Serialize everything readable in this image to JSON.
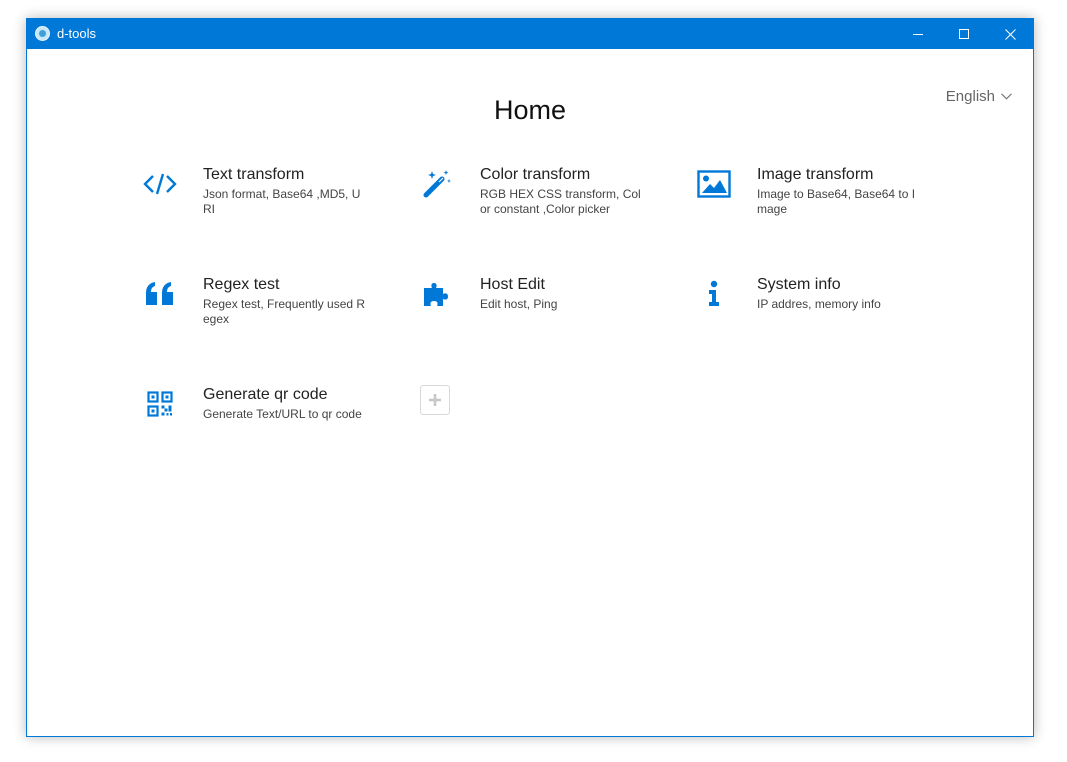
{
  "window": {
    "title": "d-tools",
    "accent": "#0078d7",
    "buttons": {
      "minimize": "minimize-icon",
      "maximize": "maximize-icon",
      "close": "close-icon"
    }
  },
  "header": {
    "title": "Home",
    "language": "English"
  },
  "tools": [
    {
      "name": "Text transform",
      "desc": "Json format, Base64 ,MD5, URI",
      "icon": "code-icon"
    },
    {
      "name": "Color transform",
      "desc": "RGB HEX CSS transform, Color constant ,Color picker",
      "icon": "magic-wand-icon"
    },
    {
      "name": "Image transform",
      "desc": "Image to Base64, Base64 to Image",
      "icon": "image-icon"
    },
    {
      "name": "Regex test",
      "desc": "Regex test, Frequently used Regex",
      "icon": "quote-icon"
    },
    {
      "name": "Host Edit",
      "desc": "Edit host, Ping",
      "icon": "puzzle-icon"
    },
    {
      "name": "System info",
      "desc": "IP addres, memory info",
      "icon": "info-icon"
    },
    {
      "name": "Generate qr code",
      "desc": "Generate Text/URL to qr code",
      "icon": "qrcode-icon"
    }
  ],
  "add_button": {
    "icon": "plus-icon"
  }
}
